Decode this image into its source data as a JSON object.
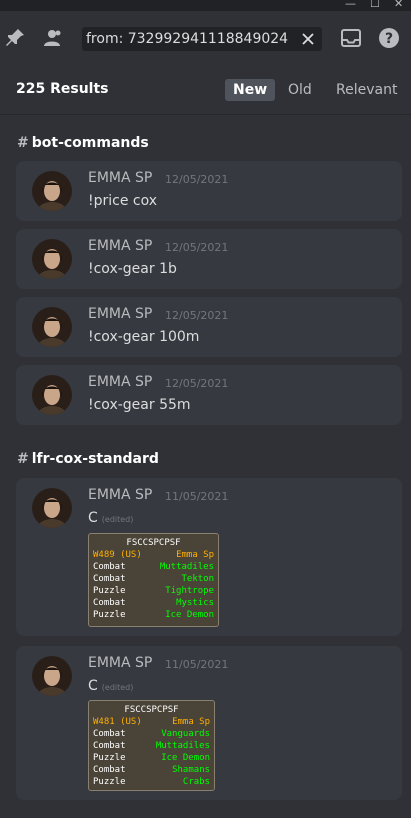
{
  "window": {
    "minimize": "—",
    "maximize": "☐",
    "close": "✕"
  },
  "toolbar": {
    "search_value": "from: 732992941118849024"
  },
  "results": {
    "count_label": "225 Results",
    "sort": {
      "new": "New",
      "old": "Old",
      "relevant": "Relevant"
    }
  },
  "groups": [
    {
      "channel": "bot-commands",
      "messages": [
        {
          "author": "EMMA SP",
          "date": "12/05/2021",
          "content": "!price cox"
        },
        {
          "author": "EMMA SP",
          "date": "12/05/2021",
          "content": "!cox-gear 1b"
        },
        {
          "author": "EMMA SP",
          "date": "12/05/2021",
          "content": "!cox-gear 100m"
        },
        {
          "author": "EMMA SP",
          "date": "12/05/2021",
          "content": "!cox-gear 55m"
        }
      ]
    },
    {
      "channel": "lfr-cox-standard",
      "messages": [
        {
          "author": "EMMA SP",
          "date": "11/05/2021",
          "content": "C",
          "edited": "(edited)",
          "attachment": {
            "title": "FSCCSPCPSF",
            "world": "W489 (US)",
            "player": "Emma Sp",
            "rows": [
              {
                "type": "Combat",
                "room": "Muttadiles"
              },
              {
                "type": "Combat",
                "room": "Tekton"
              },
              {
                "type": "Puzzle",
                "room": "Tightrope"
              },
              {
                "type": "Combat",
                "room": "Mystics"
              },
              {
                "type": "Puzzle",
                "room": "Ice Demon"
              }
            ]
          }
        },
        {
          "author": "EMMA SP",
          "date": "11/05/2021",
          "content": "C",
          "edited": "(edited)",
          "attachment": {
            "title": "FSCCSPCPSF",
            "world": "W481 (US)",
            "player": "Emma Sp",
            "rows": [
              {
                "type": "Combat",
                "room": "Vanguards"
              },
              {
                "type": "Combat",
                "room": "Muttadiles"
              },
              {
                "type": "Puzzle",
                "room": "Ice Demon"
              },
              {
                "type": "Combat",
                "room": "Shamans"
              },
              {
                "type": "Puzzle",
                "room": "Crabs"
              }
            ]
          }
        }
      ]
    }
  ]
}
